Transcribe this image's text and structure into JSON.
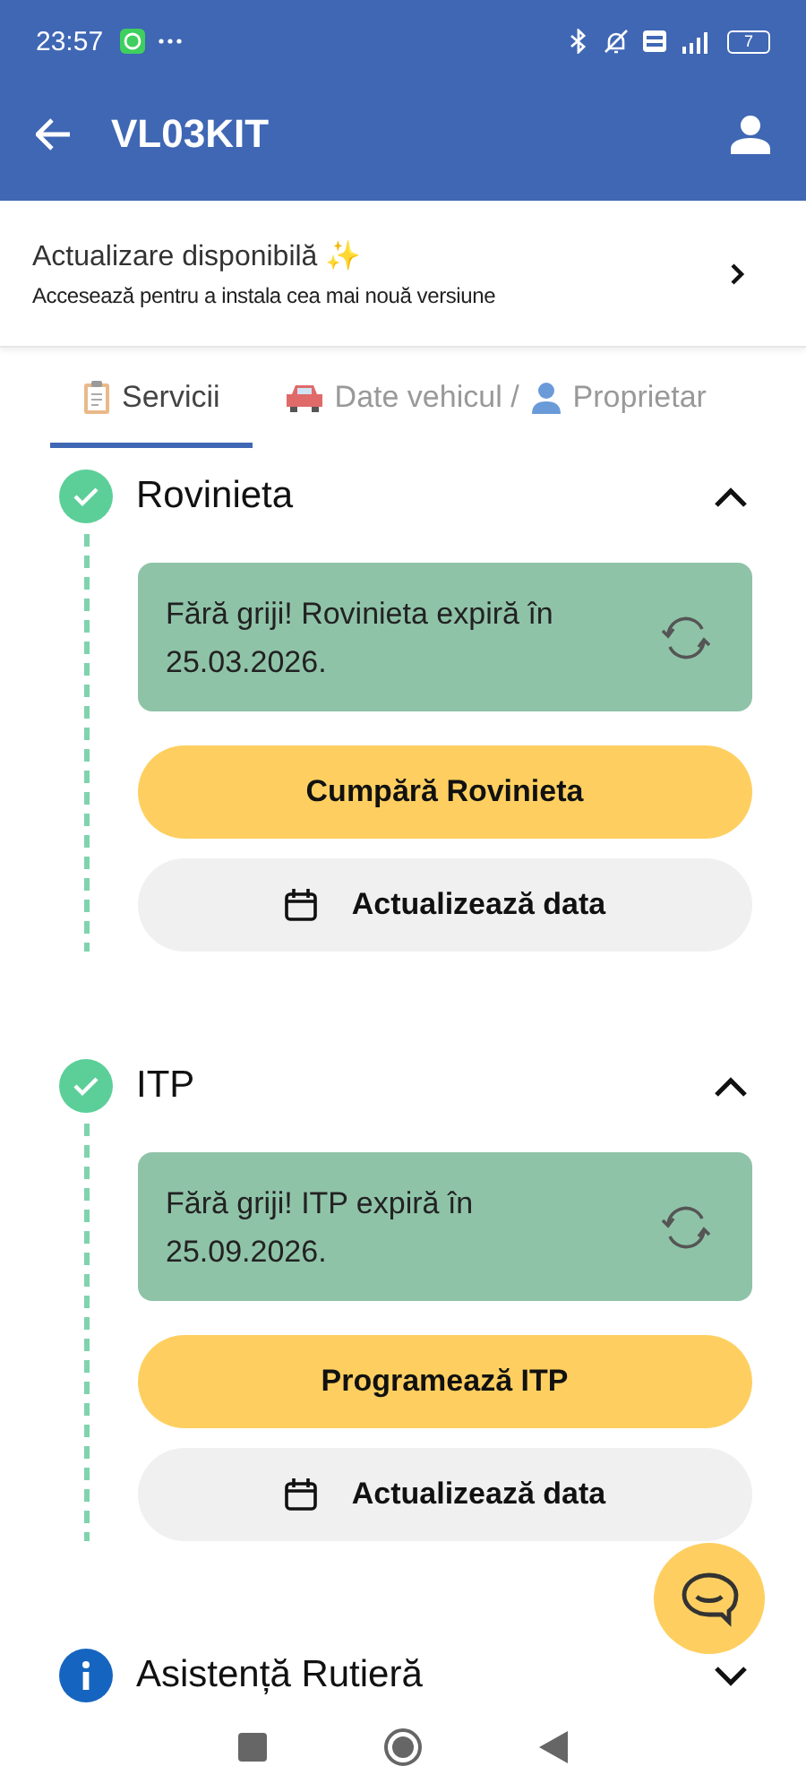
{
  "status_bar": {
    "time": "23:57",
    "battery": "7"
  },
  "app_bar": {
    "title": "VL03KIT"
  },
  "update_banner": {
    "title": "Actualizare disponibilă ✨",
    "subtitle": "Accesează pentru a instala cea mai nouă versiune"
  },
  "tabs": [
    {
      "kind": "services",
      "parts": [
        "Servicii"
      ],
      "selected": true
    },
    {
      "kind": "vehicle",
      "parts": [
        "Date vehicul /",
        "Proprietar"
      ],
      "selected": false
    }
  ],
  "sections": [
    {
      "title": "Rovinieta",
      "kind": "done",
      "expanded": true,
      "message": "Fără griji! Rovinieta expiră în 25.03.2026.",
      "buttons": [
        {
          "kind": "primary",
          "label": "Cumpără Rovinieta"
        },
        {
          "kind": "secondary",
          "label": "Actualizează data"
        }
      ]
    },
    {
      "title": "ITP",
      "kind": "done",
      "expanded": true,
      "message": "Fără griji! ITP expiră în 25.09.2026.",
      "buttons": [
        {
          "kind": "primary",
          "label": "Programează ITP"
        },
        {
          "kind": "secondary",
          "label": "Actualizează data"
        }
      ]
    },
    {
      "title": "Asistență Rutieră",
      "kind": "info",
      "expanded": false
    }
  ]
}
